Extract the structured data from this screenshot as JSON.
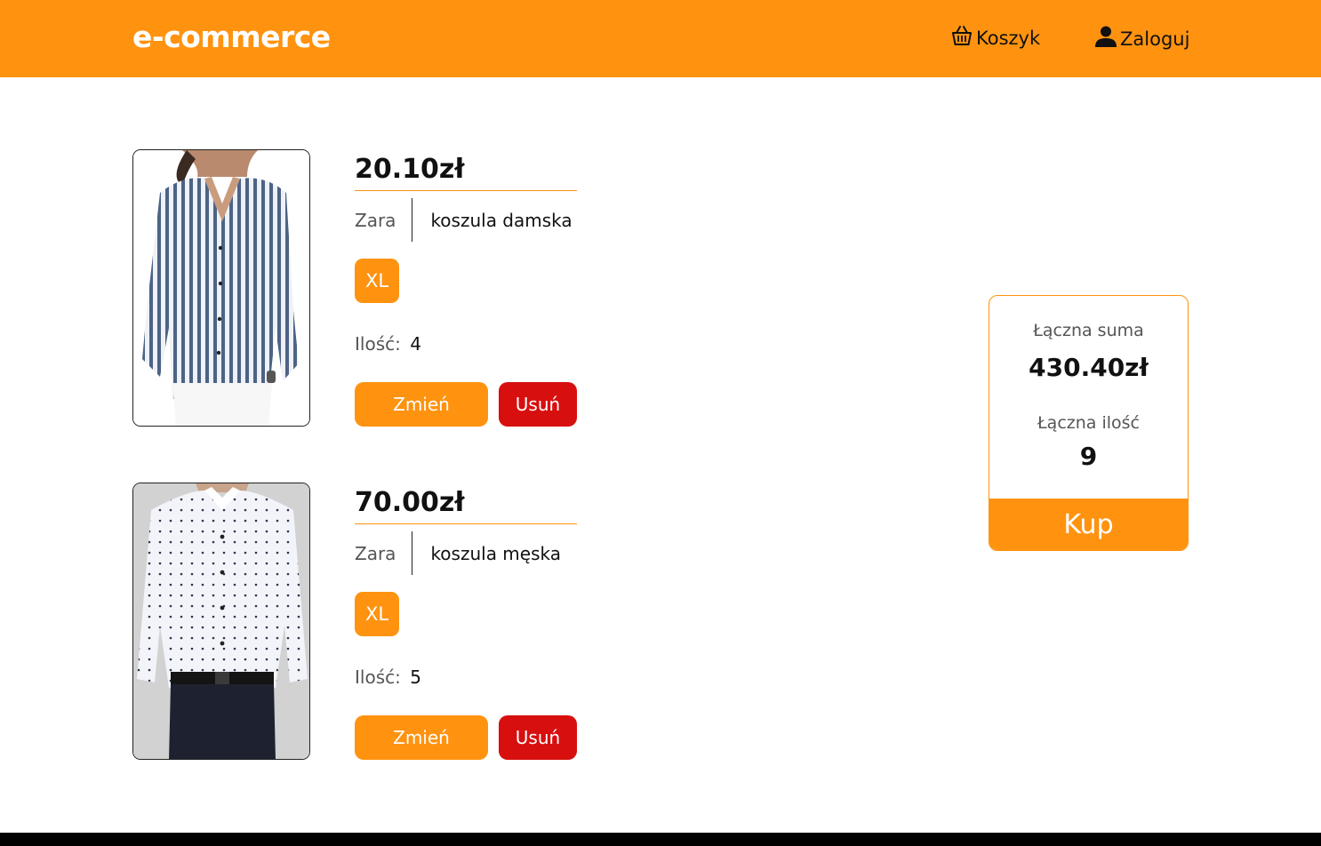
{
  "header": {
    "brand": "e-commerce",
    "cart_label": "Koszyk",
    "login_label": "Zaloguj"
  },
  "cart": {
    "items": [
      {
        "price": "20.10zł",
        "brand": "Zara",
        "name": "koszula damska",
        "size": "XL",
        "qty_label": "Ilość:",
        "qty": "4",
        "change_label": "Zmień",
        "remove_label": "Usuń"
      },
      {
        "price": "70.00zł",
        "brand": "Zara",
        "name": "koszula męska",
        "size": "XL",
        "qty_label": "Ilość:",
        "qty": "5",
        "change_label": "Zmień",
        "remove_label": "Usuń"
      }
    ]
  },
  "summary": {
    "total_label": "Łączna suma",
    "total_value": "430.40zł",
    "qty_label": "Łączna ilość",
    "qty_value": "9",
    "buy_label": "Kup"
  },
  "colors": {
    "accent": "#ff9310",
    "danger": "#d80f0f",
    "footer": "#000000"
  },
  "icons": {
    "cart": "basket-icon",
    "login": "user-icon"
  }
}
